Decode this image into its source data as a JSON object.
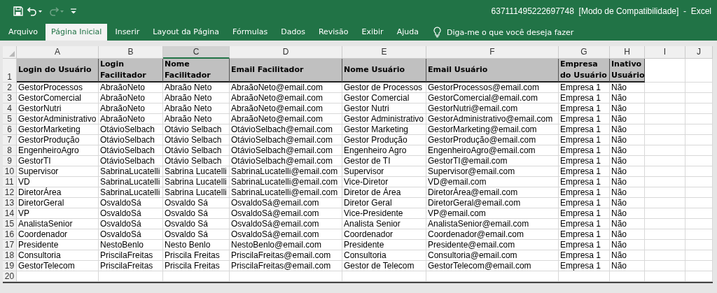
{
  "window": {
    "title": "637111495222697748  [Modo de Compatibilidade]  -  Excel"
  },
  "ribbon_tabs": [
    {
      "label": "Arquivo",
      "selected": false
    },
    {
      "label": "Página Inicial",
      "selected": true
    },
    {
      "label": "Inserir",
      "selected": false
    },
    {
      "label": "Layout da Página",
      "selected": false
    },
    {
      "label": "Fórmulas",
      "selected": false
    },
    {
      "label": "Dados",
      "selected": false
    },
    {
      "label": "Revisão",
      "selected": false
    },
    {
      "label": "Exibir",
      "selected": false
    },
    {
      "label": "Ajuda",
      "selected": false
    }
  ],
  "tell_me": {
    "placeholder": "Diga-me o que você deseja fazer"
  },
  "sheet": {
    "columns": [
      {
        "letter": "A",
        "selected": false
      },
      {
        "letter": "B",
        "selected": false
      },
      {
        "letter": "C",
        "selected": true
      },
      {
        "letter": "D",
        "selected": false
      },
      {
        "letter": "E",
        "selected": false
      },
      {
        "letter": "F",
        "selected": false
      },
      {
        "letter": "G",
        "selected": false
      },
      {
        "letter": "H",
        "selected": false
      },
      {
        "letter": "I",
        "selected": false
      },
      {
        "letter": "J",
        "selected": false
      }
    ],
    "header_row": {
      "number": "1",
      "cells": [
        "Login do Usuário",
        "Login Facilitador",
        "Nome Facilitador",
        "Email Facilitador",
        "Nome Usuário",
        "Email Usuário",
        "Empresa do Usuário",
        "Inativo Usuário"
      ]
    },
    "rows": [
      {
        "number": "2",
        "cells": [
          "GestorProcessos",
          "AbraãoNeto",
          "Abraão Neto",
          "AbraãoNeto@email.com",
          "Gestor de Processos",
          "GestorProcessos@email.com",
          "Empresa 1",
          "Não"
        ]
      },
      {
        "number": "3",
        "cells": [
          "GestorComercial",
          "AbraãoNeto",
          "Abraão Neto",
          "AbraãoNeto@email.com",
          "Gestor Comercial",
          "GestorComercial@email.com",
          "Empresa 1",
          "Não"
        ]
      },
      {
        "number": "4",
        "cells": [
          "GestorNutri",
          "AbraãoNeto",
          "Abraão Neto",
          "AbraãoNeto@email.com",
          "Gestor Nutri",
          "GestorNutri@email.com",
          "Empresa 1",
          "Não"
        ]
      },
      {
        "number": "5",
        "cells": [
          "GestorAdministrativo",
          "AbraãoNeto",
          "Abraão Neto",
          "AbraãoNeto@email.com",
          "Gestor Administrativo",
          "GestorAdministrativo@email.com",
          "Empresa 1",
          "Não"
        ]
      },
      {
        "number": "6",
        "cells": [
          "GestorMarketing",
          "OtávioSelbach",
          "Otávio Selbach",
          "OtávioSelbach@email.com",
          "Gestor Marketing",
          "GestorMarketing@email.com",
          "Empresa 1",
          "Não"
        ]
      },
      {
        "number": "7",
        "cells": [
          "GestorProdução",
          "OtávioSelbach",
          "Otávio Selbach",
          "OtávioSelbach@email.com",
          "Gestor Produção",
          "GestorProdução@email.com",
          "Empresa 1",
          "Não"
        ]
      },
      {
        "number": "8",
        "cells": [
          "EngenheiroAgro",
          "OtávioSelbach",
          "Otávio Selbach",
          "OtávioSelbach@email.com",
          "Engenheiro Agro",
          "EngenheiroAgro@email.com",
          "Empresa 1",
          "Não"
        ]
      },
      {
        "number": "9",
        "cells": [
          "GestorTI",
          "OtávioSelbach",
          "Otávio Selbach",
          "OtávioSelbach@email.com",
          "Gestor de TI",
          "GestorTI@email.com",
          "Empresa 1",
          "Não"
        ]
      },
      {
        "number": "10",
        "cells": [
          "Supervisor",
          "SabrinaLucatelli",
          "Sabrina Lucatelli",
          "SabrinaLucatelli@email.com",
          "Supervisor",
          "Supervisor@email.com",
          "Empresa 1",
          "Não"
        ]
      },
      {
        "number": "11",
        "cells": [
          "VD",
          "SabrinaLucatelli",
          "Sabrina Lucatelli",
          "SabrinaLucatelli@email.com",
          "Vice-Diretor",
          "VD@email.com",
          "Empresa 1",
          "Não"
        ]
      },
      {
        "number": "12",
        "cells": [
          "DiretorÁrea",
          "SabrinaLucatelli",
          "Sabrina Lucatelli",
          "SabrinaLucatelli@email.com",
          "Diretor de Área",
          "DiretorÁrea@email.com",
          "Empresa 1",
          "Não"
        ]
      },
      {
        "number": "13",
        "cells": [
          "DiretorGeral",
          "OsvaldoSá",
          "Osvaldo Sá",
          "OsvaldoSá@email.com",
          "Diretor Geral",
          "DiretorGeral@email.com",
          "Empresa 1",
          "Não"
        ]
      },
      {
        "number": "14",
        "cells": [
          "VP",
          "OsvaldoSá",
          "Osvaldo Sá",
          "OsvaldoSá@email.com",
          "Vice-Presidente",
          "VP@email.com",
          "Empresa 1",
          "Não"
        ]
      },
      {
        "number": "15",
        "cells": [
          "AnalistaSenior",
          "OsvaldoSá",
          "Osvaldo Sá",
          "OsvaldoSá@email.com",
          "Analista Senior",
          "AnalistaSenior@email.com",
          "Empresa 1",
          "Não"
        ]
      },
      {
        "number": "16",
        "cells": [
          "Coordenador",
          "OsvaldoSá",
          "Osvaldo Sá",
          "OsvaldoSá@email.com",
          "Coordenador",
          "Coordenador@email.com",
          "Empresa 1",
          "Não"
        ]
      },
      {
        "number": "17",
        "cells": [
          "Presidente",
          "NestoBenlo",
          "Nesto Benlo",
          "NestoBenlo@email.com",
          "Presidente",
          "Presidente@email.com",
          "Empresa 1",
          "Não"
        ]
      },
      {
        "number": "18",
        "cells": [
          "Consultoria",
          "PriscilaFreitas",
          "Priscila Freitas",
          "PriscilaFreitas@email.com",
          "Consultoria",
          "Consultoria@email.com",
          "Empresa 1",
          "Não"
        ]
      },
      {
        "number": "19",
        "cells": [
          "GestorTelecom",
          "PriscilaFreitas",
          "Priscila Freitas",
          "PriscilaFreitas@email.com",
          "Gestor de Telecom",
          "GestorTelecom@email.com",
          "Empresa 1",
          "Não"
        ]
      },
      {
        "number": "20"
      }
    ]
  }
}
